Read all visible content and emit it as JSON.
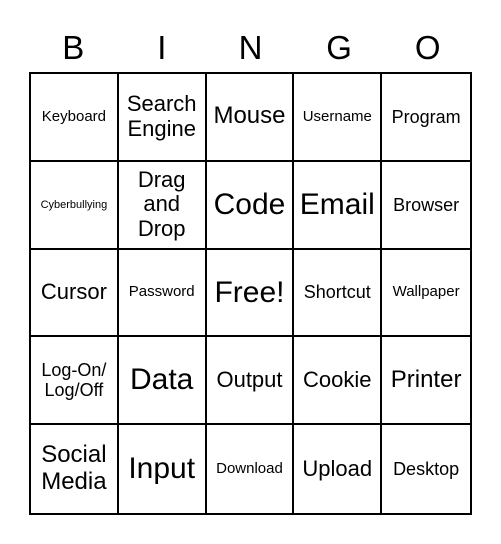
{
  "header": {
    "letters": [
      "B",
      "I",
      "N",
      "G",
      "O"
    ]
  },
  "grid": {
    "cells": [
      [
        "Keyboard",
        "Search Engine",
        "Mouse",
        "Username",
        "Program"
      ],
      [
        "Cyberbullying",
        "Drag and Drop",
        "Code",
        "Email",
        "Browser"
      ],
      [
        "Cursor",
        "Password",
        "Free!",
        "Shortcut",
        "Wallpaper"
      ],
      [
        "Log-On/ Log/Off",
        "Data",
        "Output",
        "Cookie",
        "Printer"
      ],
      [
        "Social Media",
        "Input",
        "Download",
        "Upload",
        "Desktop"
      ]
    ]
  }
}
